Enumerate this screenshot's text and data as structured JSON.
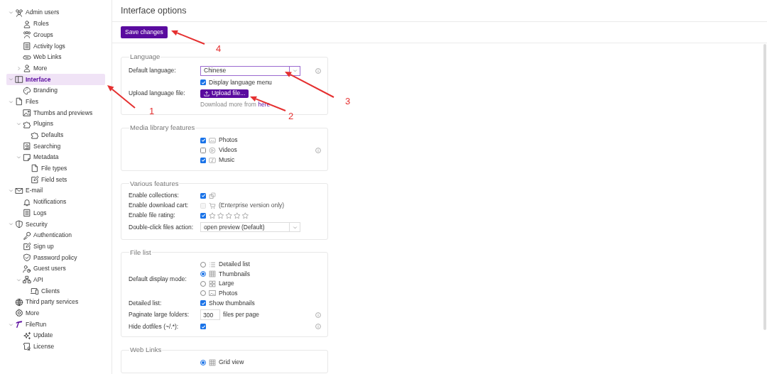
{
  "sidebar": {
    "items": [
      {
        "label": "Admin users",
        "expanded": true,
        "selected": false,
        "children": [
          {
            "label": "Roles",
            "selected": false
          },
          {
            "label": "Groups",
            "selected": false
          },
          {
            "label": "Activity logs",
            "selected": false
          },
          {
            "label": "Web Links",
            "selected": false
          },
          {
            "label": "More",
            "expanded": false,
            "selected": false
          }
        ]
      },
      {
        "label": "Interface",
        "expanded": true,
        "selected": true,
        "children": [
          {
            "label": "Branding",
            "selected": false
          }
        ]
      },
      {
        "label": "Files",
        "expanded": true,
        "selected": false,
        "children": [
          {
            "label": "Thumbs and previews",
            "selected": false
          },
          {
            "label": "Plugins",
            "expanded": true,
            "selected": false,
            "children": [
              {
                "label": "Defaults",
                "selected": false
              }
            ]
          },
          {
            "label": "Searching",
            "selected": false
          },
          {
            "label": "Metadata",
            "expanded": true,
            "selected": false,
            "children": [
              {
                "label": "File types",
                "selected": false
              },
              {
                "label": "Field sets",
                "selected": false
              }
            ]
          }
        ]
      },
      {
        "label": "E-mail",
        "expanded": true,
        "selected": false,
        "children": [
          {
            "label": "Notifications",
            "selected": false
          },
          {
            "label": "Logs",
            "selected": false
          }
        ]
      },
      {
        "label": "Security",
        "expanded": true,
        "selected": false,
        "children": [
          {
            "label": "Authentication",
            "selected": false
          },
          {
            "label": "Sign up",
            "selected": false
          },
          {
            "label": "Password policy",
            "selected": false
          },
          {
            "label": "Guest users",
            "selected": false
          },
          {
            "label": "API",
            "expanded": true,
            "selected": false,
            "children": [
              {
                "label": "Clients",
                "selected": false
              }
            ]
          }
        ]
      },
      {
        "label": "Third party services",
        "selected": false
      },
      {
        "label": "More",
        "selected": false
      },
      {
        "label": "FileRun",
        "expanded": true,
        "selected": false,
        "children": [
          {
            "label": "Update",
            "selected": false
          },
          {
            "label": "License",
            "selected": false
          }
        ]
      }
    ]
  },
  "page": {
    "title": "Interface options",
    "save_button": "Save changes"
  },
  "sections": [
    {
      "title": "Language",
      "rows": [
        {
          "kind": "select",
          "label": "Default language:",
          "value": "Chinese",
          "focused": true,
          "info": true
        },
        {
          "kind": "check",
          "text": "Display language menu",
          "checked": true,
          "disabled": false
        },
        {
          "kind": "upload",
          "label": "Upload language file:",
          "button": "Upload file..."
        },
        {
          "kind": "note",
          "text": "Download more from",
          "link": "here"
        }
      ]
    },
    {
      "title": "Media library features",
      "rows": [
        {
          "kind": "check",
          "text": "Photos",
          "checked": true,
          "disabled": false
        },
        {
          "kind": "check",
          "text": "Videos",
          "checked": false,
          "disabled": false,
          "info": true
        },
        {
          "kind": "check",
          "text": "Music",
          "checked": true,
          "disabled": false
        }
      ]
    },
    {
      "title": "Various features",
      "rows": [
        {
          "kind": "check",
          "label": "Enable collections:",
          "checked": true,
          "disabled": false
        },
        {
          "kind": "check",
          "label": "Enable download cart:",
          "text": "(Enterprise version only)",
          "checked": false,
          "disabled": true
        },
        {
          "kind": "check",
          "label": "Enable file rating:",
          "checked": true,
          "disabled": false
        },
        {
          "kind": "select",
          "label": "Double-click files action:",
          "value": "open preview (Default)",
          "focused": false
        }
      ]
    },
    {
      "title": "File list",
      "rows": [
        {
          "kind": "radios",
          "label": "Default display mode:",
          "options": [
            {
              "text": "Detailed list",
              "selected": false
            },
            {
              "text": "Thumbnails",
              "selected": true
            },
            {
              "text": "Large",
              "selected": false
            },
            {
              "text": "Photos",
              "selected": false
            }
          ]
        },
        {
          "kind": "check",
          "label": "Detailed list:",
          "text": "Show thumbnails",
          "checked": true,
          "disabled": false
        },
        {
          "kind": "number",
          "label": "Paginate large folders:",
          "value": "300",
          "suffix": "files per page",
          "info": true
        },
        {
          "kind": "check",
          "label": "Hide dotfiles (~/.*):",
          "checked": true,
          "disabled": false,
          "info": true
        }
      ]
    },
    {
      "title": "Web Links",
      "rows": [
        {
          "kind": "radios",
          "options": [
            {
              "text": "Grid view",
              "selected": true
            }
          ]
        }
      ]
    }
  ],
  "annotations": [
    {
      "label": "1"
    },
    {
      "label": "2"
    },
    {
      "label": "3"
    },
    {
      "label": "4"
    }
  ]
}
